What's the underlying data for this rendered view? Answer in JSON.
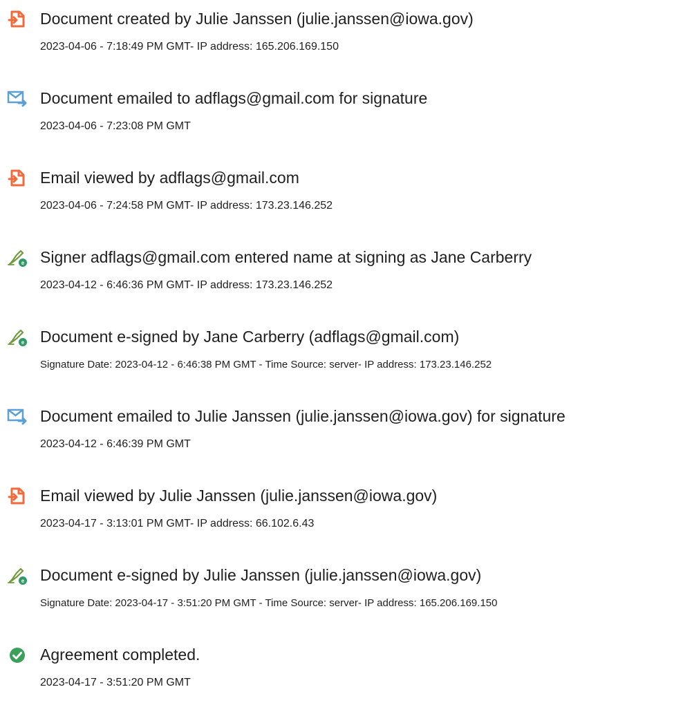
{
  "events": [
    {
      "icon": "document-created-icon",
      "title": "Document created by Julie Janssen (julie.janssen@iowa.gov)",
      "detail": "2023-04-06 - 7:18:49 PM GMT- IP address: 165.206.169.150"
    },
    {
      "icon": "email-sent-icon",
      "title": "Document emailed to adflags@gmail.com for signature",
      "detail": "2023-04-06 - 7:23:08 PM GMT"
    },
    {
      "icon": "document-viewed-icon",
      "title": "Email viewed by adflags@gmail.com",
      "detail": "2023-04-06 - 7:24:58 PM GMT- IP address: 173.23.146.252"
    },
    {
      "icon": "e-sign-pen-icon",
      "title": "Signer adflags@gmail.com entered name at signing as Jane Carberry",
      "detail": "2023-04-12 - 6:46:36 PM GMT- IP address: 173.23.146.252"
    },
    {
      "icon": "e-sign-pen-icon",
      "title": "Document e-signed by Jane Carberry (adflags@gmail.com)",
      "detail": "Signature Date: 2023-04-12 - 6:46:38 PM GMT - Time Source: server- IP address: 173.23.146.252"
    },
    {
      "icon": "email-sent-icon",
      "title": "Document emailed to Julie Janssen (julie.janssen@iowa.gov) for signature",
      "detail": "2023-04-12 - 6:46:39 PM GMT"
    },
    {
      "icon": "document-viewed-icon",
      "title": "Email viewed by Julie Janssen (julie.janssen@iowa.gov)",
      "detail": "2023-04-17 - 3:13:01 PM GMT- IP address: 66.102.6.43"
    },
    {
      "icon": "e-sign-pen-icon",
      "title": "Document e-signed by Julie Janssen (julie.janssen@iowa.gov)",
      "detail": "Signature Date: 2023-04-17 - 3:51:20 PM GMT - Time Source: server- IP address: 165.206.169.150"
    },
    {
      "icon": "completed-checkmark-icon",
      "title": "Agreement completed.",
      "detail": "2023-04-17 - 3:51:20 PM GMT"
    }
  ],
  "colors": {
    "document_icon": "#f06a3b",
    "email_icon": "#5aa0d6",
    "pen_icon": "#6f9a3d",
    "badge": "#2f9a64",
    "check": "#3aa15a",
    "text": "#1f1f1f"
  }
}
